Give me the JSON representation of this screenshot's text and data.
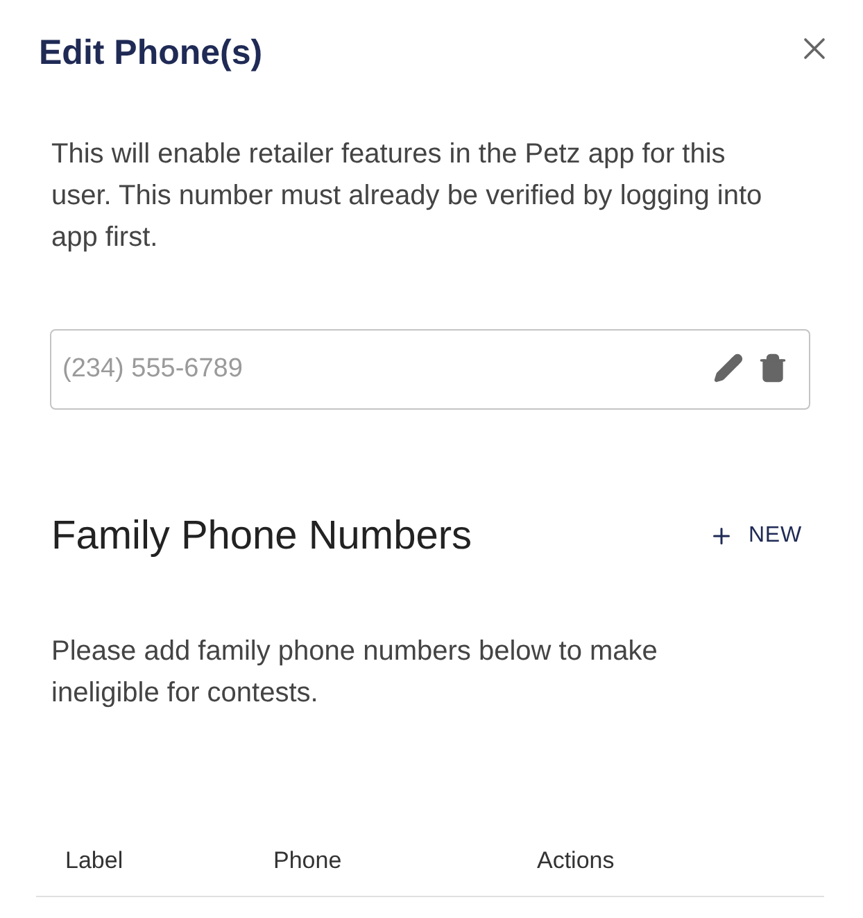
{
  "dialog": {
    "title": "Edit Phone(s)"
  },
  "description": "This will enable retailer features in the Petz app for this user. This number must already be verified by logging into app first.",
  "phone_field": {
    "placeholder": "(234) 555-6789"
  },
  "family_section": {
    "heading": "Family Phone Numbers",
    "new_button": "NEW",
    "description": "Please add family phone numbers below to make ineligible for contests."
  },
  "table": {
    "columns": [
      "Label",
      "Phone",
      "Actions"
    ]
  }
}
